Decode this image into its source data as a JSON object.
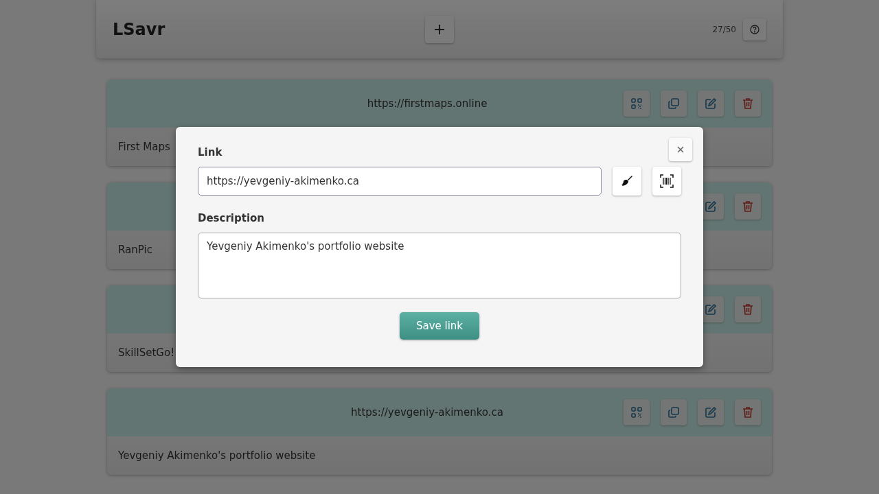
{
  "header": {
    "title": "LSavr",
    "count": "27/50"
  },
  "links": [
    {
      "url": "https://firstmaps.online",
      "description": "First Maps"
    },
    {
      "description": "RanPic"
    },
    {
      "description": "SkillSetGo!"
    },
    {
      "url": "https://yevgeniy-akimenko.ca",
      "description": "Yevgeniy Akimenko's portfolio website"
    }
  ],
  "dialog": {
    "link_label": "Link",
    "link_value": "https://yevgeniy-akimenko.ca",
    "description_label": "Description",
    "description_value": "Yevgeniy Akimenko's portfolio website",
    "save_button": "Save link"
  }
}
